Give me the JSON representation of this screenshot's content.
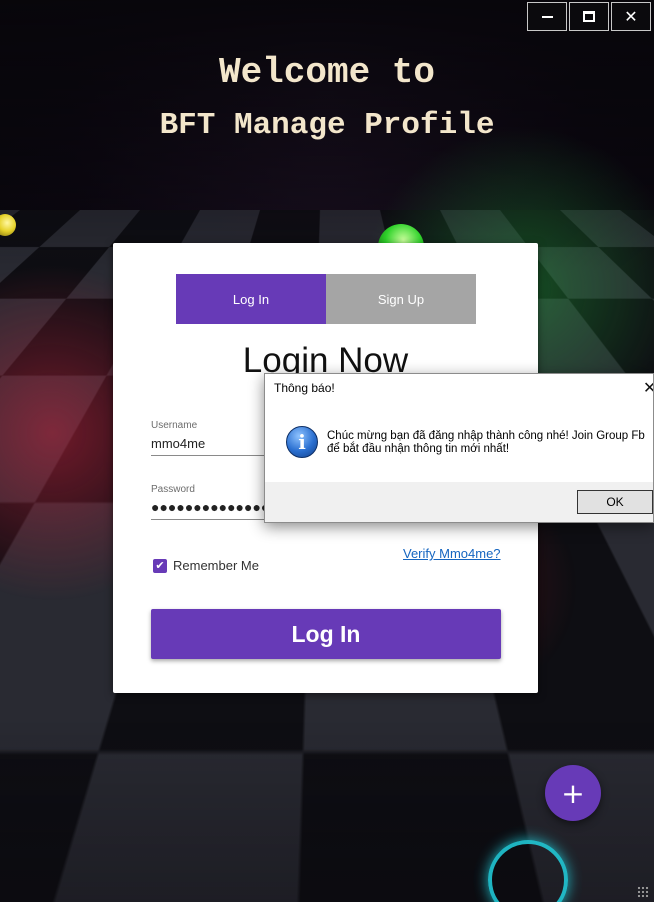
{
  "window": {
    "minimize_icon": "minimize-icon",
    "maximize_icon": "maximize-icon",
    "close_glyph": "✕"
  },
  "header": {
    "line1": "Welcome to",
    "line2": "BFT Manage Profile"
  },
  "card": {
    "tabs": [
      {
        "label": "Log In",
        "active": true
      },
      {
        "label": "Sign Up",
        "active": false
      }
    ],
    "title": "Login Now",
    "username": {
      "label": "Username",
      "value": "mmo4me"
    },
    "password": {
      "label": "Password",
      "value": "●●●●●●●●●●●●●●●●●●●●●●●●●●●●●●"
    },
    "verify_link": "Verify Mmo4me?",
    "remember": {
      "label": "Remember Me",
      "checked": true
    },
    "login_button": "Log In"
  },
  "fab": {
    "glyph": "+",
    "icon": "plus-icon"
  },
  "dialog": {
    "title": "Thông báo!",
    "close_glyph": "✕",
    "icon": "info-icon",
    "icon_glyph": "i",
    "message": "Chúc mừng bạn đã đăng nhập thành công nhé! Join Group Fb để bắt đầu nhận thông tin mới nhất!",
    "ok_label": "OK"
  },
  "colors": {
    "accent": "#673ab7",
    "tab_inactive": "#a5a5a5",
    "title_text": "#f3e6cb",
    "link": "#1565c0"
  }
}
